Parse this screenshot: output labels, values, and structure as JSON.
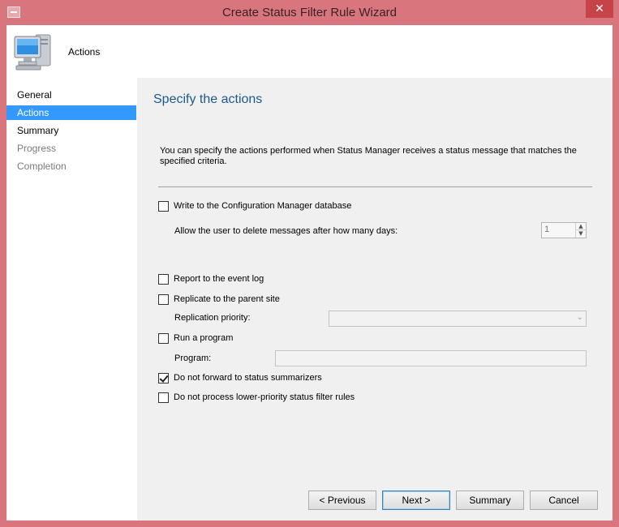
{
  "window": {
    "title": "Create Status Filter Rule Wizard",
    "close_glyph": "✕",
    "icon": "window-system-icon"
  },
  "header": {
    "title": "Actions",
    "icon": "computer-icon"
  },
  "nav": {
    "items": [
      {
        "label": "General",
        "state": "normal"
      },
      {
        "label": "Actions",
        "state": "active"
      },
      {
        "label": "Summary",
        "state": "normal"
      },
      {
        "label": "Progress",
        "state": "disabled"
      },
      {
        "label": "Completion",
        "state": "disabled"
      }
    ]
  },
  "main": {
    "heading": "Specify the actions",
    "description": "You can specify the actions performed when Status Manager receives a status message that matches the specified criteria.",
    "options": {
      "write_db": {
        "label": "Write to the Configuration Manager database",
        "checked": false
      },
      "delete_days_label": "Allow the user to delete messages after how many days:",
      "delete_days_value": "1",
      "report_event_log": {
        "label": "Report to the event log",
        "checked": false
      },
      "replicate_parent": {
        "label": "Replicate to the parent site",
        "checked": false
      },
      "replication_priority_label": "Replication priority:",
      "replication_priority_value": "",
      "run_program": {
        "label": "Run a program",
        "checked": false
      },
      "program_label": "Program:",
      "program_value": "",
      "no_forward": {
        "label": "Do not forward to status summarizers",
        "checked": true
      },
      "no_process_lower": {
        "label": "Do not process lower-priority status filter rules",
        "checked": false
      }
    }
  },
  "footer": {
    "previous": "< Previous",
    "next": "Next >",
    "summary": "Summary",
    "cancel": "Cancel"
  },
  "colors": {
    "frame": "#d8757d",
    "accent": "#3399ff",
    "heading": "#1c5a8c"
  }
}
